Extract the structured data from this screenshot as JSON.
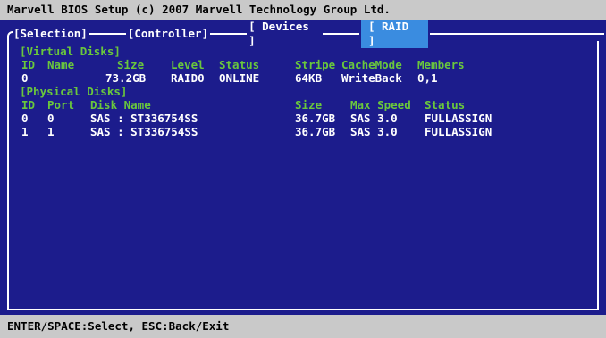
{
  "title": "Marvell BIOS Setup (c) 2007 Marvell Technology Group Ltd.",
  "tabs": [
    {
      "label": "[Selection]",
      "active": false
    },
    {
      "label": "[Controller]",
      "active": false
    },
    {
      "label": "[ Devices ]",
      "active": false
    },
    {
      "label": "[  RAID  ]",
      "active": true
    }
  ],
  "virtual_disks": {
    "section_label": "[Virtual Disks]",
    "headers": {
      "id": "ID",
      "name": "Name",
      "size": "Size",
      "level": "Level",
      "status": "Status",
      "stripe": "Stripe",
      "cachemode": "CacheMode",
      "members": "Members"
    },
    "rows": [
      {
        "id": "0",
        "name": "",
        "size": "73.2GB",
        "level": "RAID0",
        "status": "ONLINE",
        "stripe": "64KB",
        "cachemode": "WriteBack",
        "members": "0,1"
      }
    ]
  },
  "physical_disks": {
    "section_label": "[Physical Disks]",
    "headers": {
      "id": "ID",
      "port": "Port",
      "disk_name": "Disk Name",
      "size": "Size",
      "max_speed": "Max Speed",
      "status": "Status"
    },
    "rows": [
      {
        "id": "0",
        "port": "0",
        "disk_name": "SAS : ST336754SS",
        "size": "36.7GB",
        "max_speed": "SAS 3.0",
        "status": "FULLASSIGN"
      },
      {
        "id": "1",
        "port": "1",
        "disk_name": "SAS : ST336754SS",
        "size": "36.7GB",
        "max_speed": "SAS 3.0",
        "status": "FULLASSIGN"
      }
    ]
  },
  "footer": "ENTER/SPACE:Select, ESC:Back/Exit",
  "colors": {
    "background": "#1c1c8c",
    "bar": "#c9c9c9",
    "label_green": "#6ac83c",
    "text_white": "#ffffff",
    "active_tab": "#3a8ce0"
  }
}
